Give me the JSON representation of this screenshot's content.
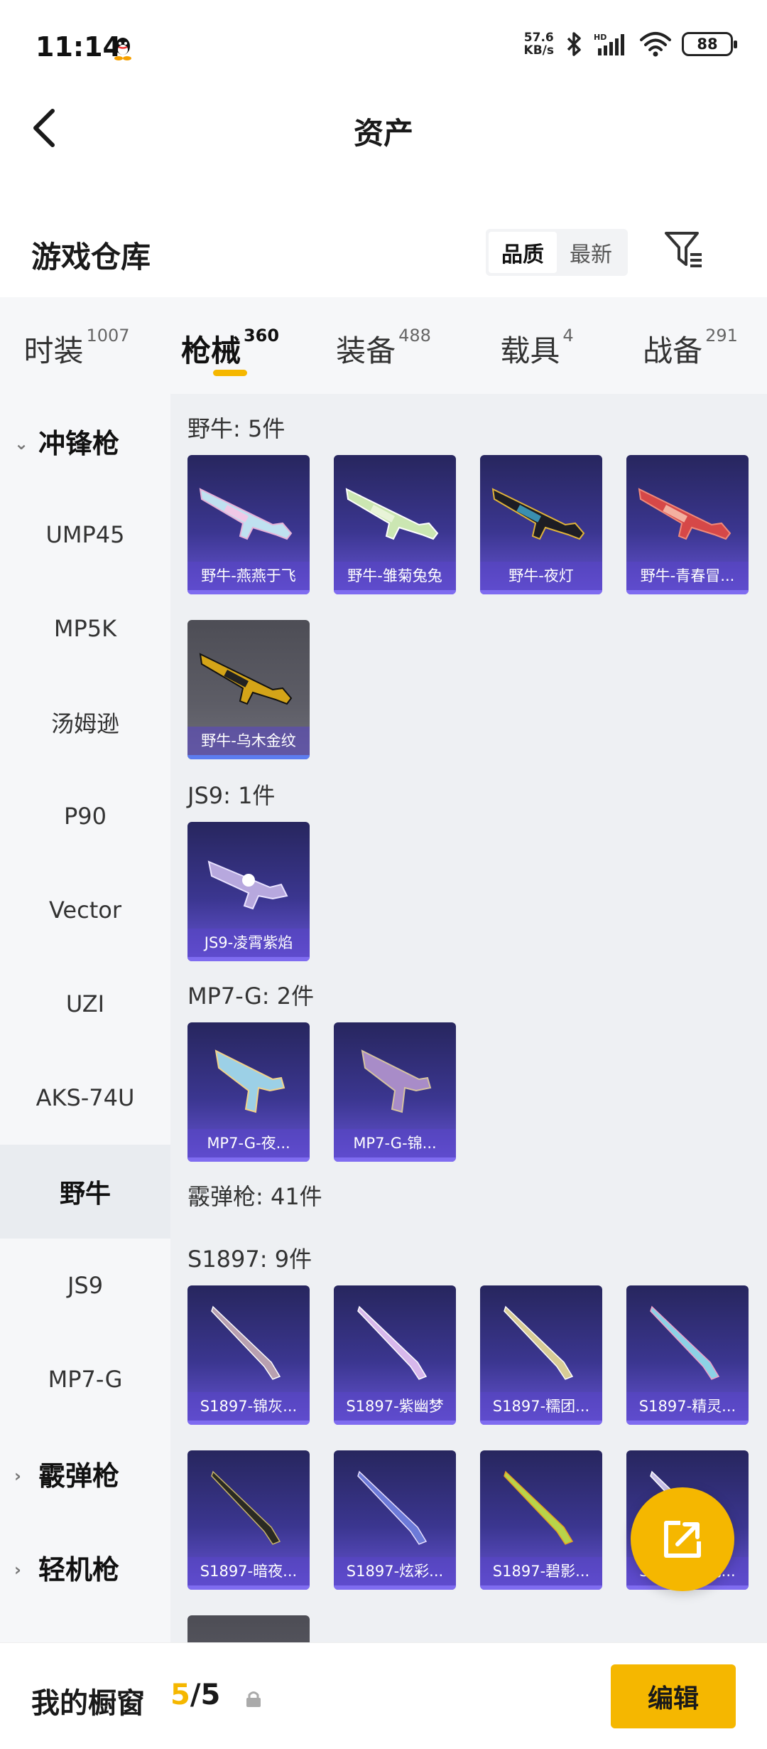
{
  "status_bar": {
    "time": "11:14",
    "net_speed_value": "57.6",
    "net_speed_unit": "KB/s",
    "signal_label": "HD",
    "battery": "88"
  },
  "header": {
    "title": "资产"
  },
  "warehouse": {
    "title": "游戏仓库",
    "sort_options": [
      "品质",
      "最新"
    ],
    "sort_selected": "品质"
  },
  "tabs": [
    {
      "label": "时装",
      "count": "1007"
    },
    {
      "label": "枪械",
      "count": "360",
      "active": true
    },
    {
      "label": "装备",
      "count": "488"
    },
    {
      "label": "载具",
      "count": "4"
    },
    {
      "label": "战备",
      "count": "291"
    }
  ],
  "sidebar": {
    "items": [
      {
        "label": "冲锋枪",
        "type": "group",
        "expanded": true
      },
      {
        "label": "UMP45"
      },
      {
        "label": "MP5K"
      },
      {
        "label": "汤姆逊"
      },
      {
        "label": "P90"
      },
      {
        "label": "Vector"
      },
      {
        "label": "UZI"
      },
      {
        "label": "AKS-74U"
      },
      {
        "label": "野牛",
        "active": true
      },
      {
        "label": "JS9"
      },
      {
        "label": "MP7-G"
      },
      {
        "label": "霰弹枪",
        "type": "group"
      },
      {
        "label": "轻机枪",
        "type": "group"
      }
    ]
  },
  "content": {
    "sections": [
      {
        "title": "野牛: 5件",
        "items": [
          "野牛-燕燕于飞",
          "野牛-雏菊兔兔",
          "野牛-夜灯",
          "野牛-青春冒...",
          "野牛-乌木金纹"
        ]
      },
      {
        "title": "JS9: 1件",
        "items": [
          "JS9-凌霄紫焰"
        ]
      },
      {
        "title": "MP7-G: 2件",
        "items": [
          "MP7-G-夜...",
          "MP7-G-锦..."
        ]
      },
      {
        "title": "霰弹枪: 41件",
        "items": []
      },
      {
        "title": "S1897: 9件",
        "items": [
          "S1897-锦灰...",
          "S1897-紫幽梦",
          "S1897-糯团...",
          "S1897-精灵...",
          "S1897-暗夜...",
          "S1897-炫彩...",
          "S1897-碧影...",
          "S1897-...她..."
        ]
      }
    ]
  },
  "bottom": {
    "label": "我的橱窗",
    "count_current": "5",
    "count_sep": "/",
    "count_max": "5",
    "edit_label": "编辑"
  },
  "colors": {
    "accent": "#f5b700",
    "card_top": "#27265e",
    "card_bottom": "#6956d8"
  }
}
